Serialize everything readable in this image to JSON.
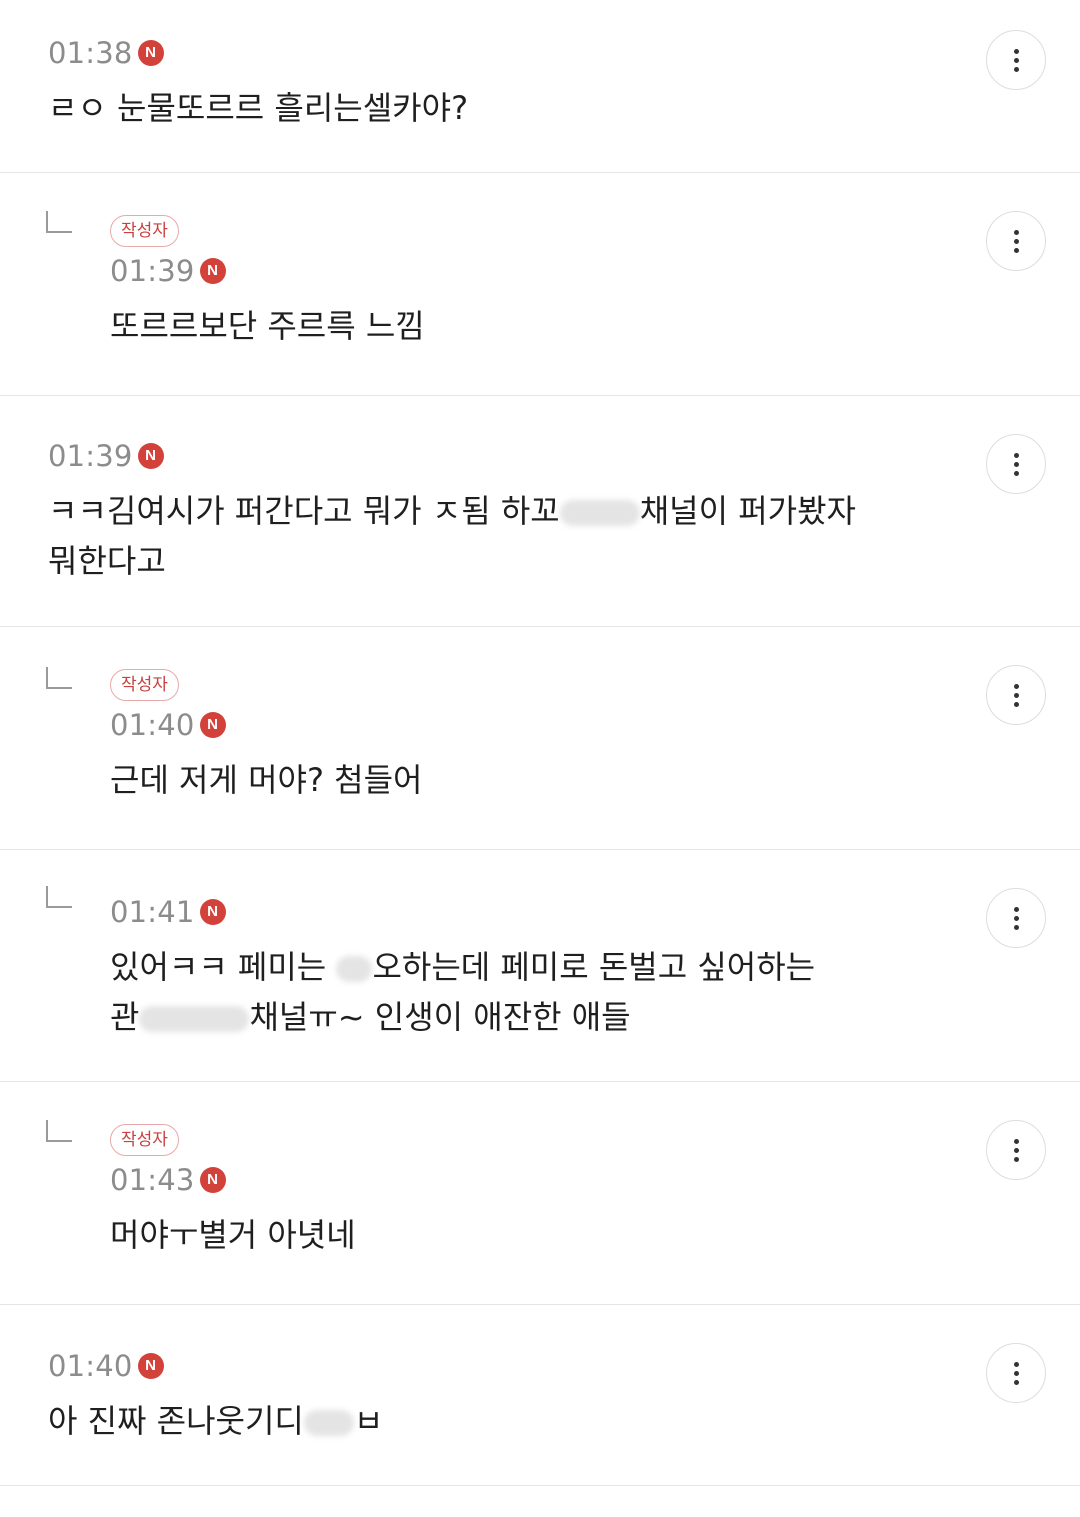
{
  "author_badge_label": "작성자",
  "new_badge_label": "N",
  "colors": {
    "new_badge": "#d2423b",
    "author_badge_text": "#c9403e",
    "author_badge_border": "#e9a9a9",
    "timestamp": "#8c8c8c",
    "divider": "#e6e6e6"
  },
  "icons": {
    "more": "more-vertical-icon",
    "reply": "reply-arrow-icon",
    "new": "new-badge-icon"
  },
  "comments": [
    {
      "time": "01:38",
      "is_reply": false,
      "is_author": false,
      "lines": [
        "ㄹㅇ 눈물또르르 흘리는셀카야?"
      ]
    },
    {
      "time": "01:39",
      "is_reply": true,
      "is_author": true,
      "lines": [
        "또르르보단 주르륵 느낌"
      ]
    },
    {
      "time": "01:39",
      "is_reply": false,
      "is_author": false,
      "lines": [
        "ㅋㅋ김여시가 퍼간다고 뭐가 ㅈ됨 하꼬",
        "채널이 퍼가봤자",
        "뭐한다고"
      ]
    },
    {
      "time": "01:40",
      "is_reply": true,
      "is_author": true,
      "lines": [
        "근데 저게 머야? 첨들어"
      ]
    },
    {
      "time": "01:41",
      "is_reply": true,
      "is_author": false,
      "lines": [
        "있어ㅋㅋ 페미는 ",
        "오하는데 페미로 돈벌고 싶어하는",
        "관",
        "채널ㅠ~ 인생이 애잔한 애들"
      ]
    },
    {
      "time": "01:43",
      "is_reply": true,
      "is_author": true,
      "lines": [
        "머야ㅜ별거 아녓네"
      ]
    },
    {
      "time": "01:40",
      "is_reply": false,
      "is_author": false,
      "lines": [
        "아 진짜 존나웃기디",
        "ㅂ"
      ]
    }
  ]
}
